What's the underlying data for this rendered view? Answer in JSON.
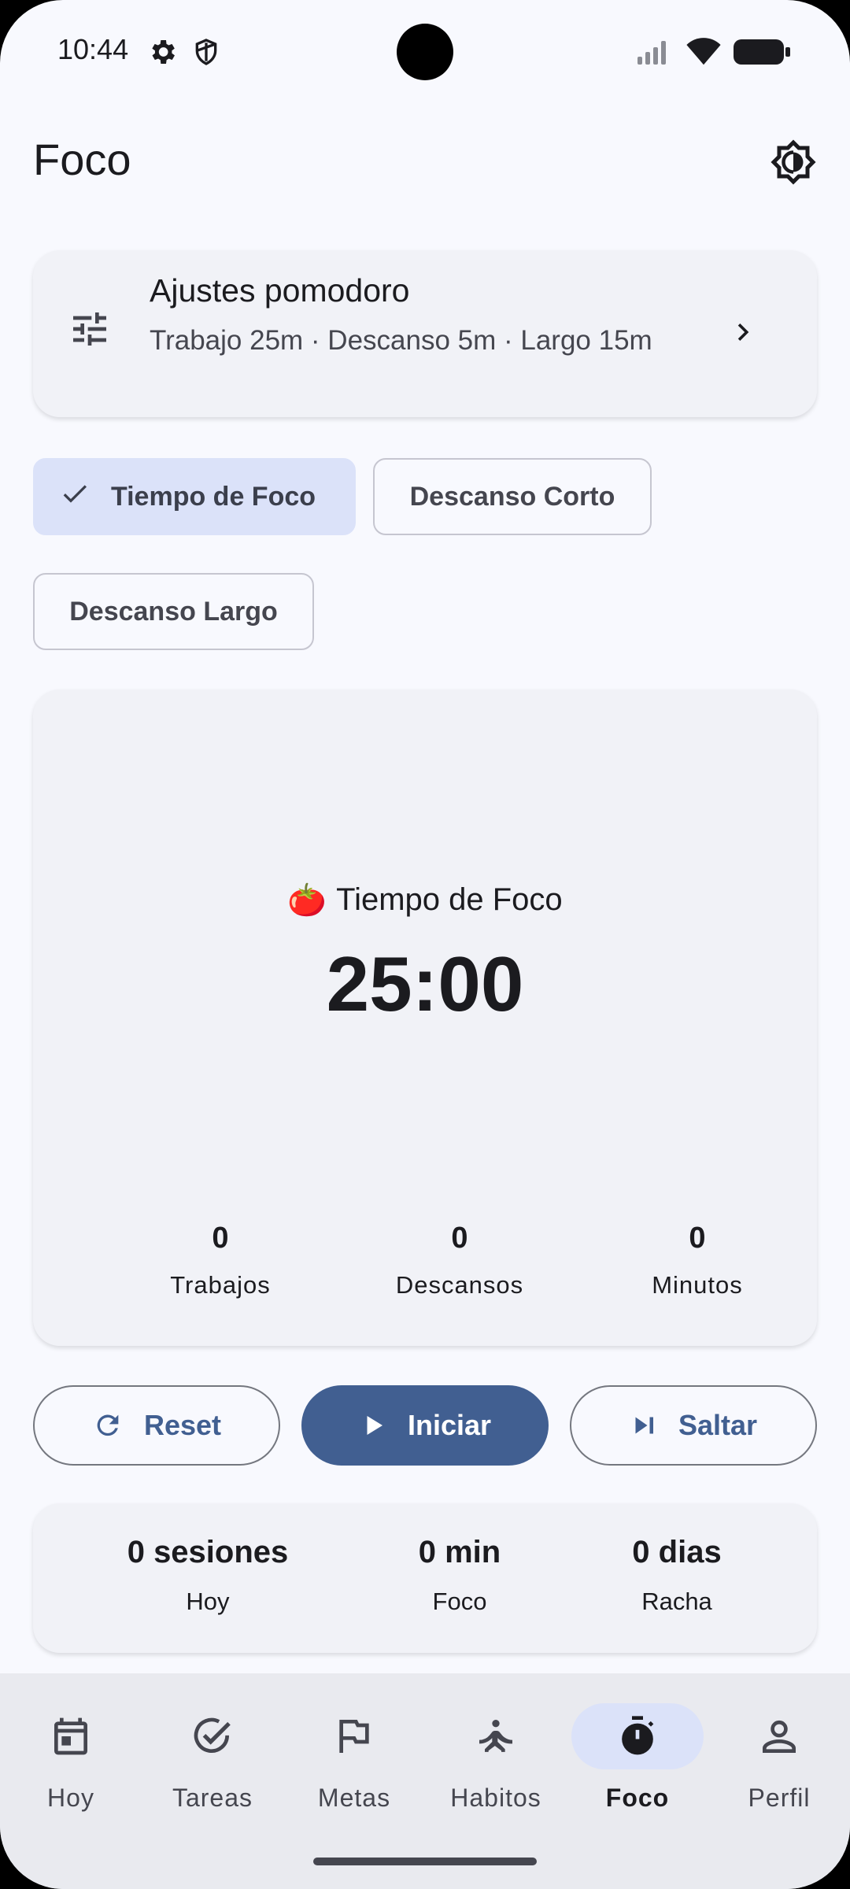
{
  "status_bar": {
    "time": "10:44",
    "left_icons": [
      "gear-icon",
      "shield-icon"
    ],
    "right_icons": [
      "signal-icon",
      "wifi-icon",
      "battery-icon"
    ]
  },
  "header": {
    "title": "Foco",
    "theme_icon": "brightness-icon"
  },
  "settings_card": {
    "title": "Ajustes pomodoro",
    "subtitle": "Trabajo 25m · Descanso 5m · Largo 15m"
  },
  "mode_chips": [
    {
      "label": "Tiempo de Foco",
      "selected": true
    },
    {
      "label": "Descanso Corto",
      "selected": false
    },
    {
      "label": "Descanso Largo",
      "selected": false
    }
  ],
  "timer": {
    "emoji": "🍅",
    "mode_label": "Tiempo de Foco",
    "display": "25:00",
    "counters": [
      {
        "value": "0",
        "label": "Trabajos"
      },
      {
        "value": "0",
        "label": "Descansos"
      },
      {
        "value": "0",
        "label": "Minutos"
      }
    ]
  },
  "controls": {
    "reset": "Reset",
    "start": "Iniciar",
    "skip": "Saltar"
  },
  "stats": [
    {
      "value": "0 sesiones",
      "label": "Hoy"
    },
    {
      "value": "0 min",
      "label": "Foco"
    },
    {
      "value": "0 dias",
      "label": "Racha"
    }
  ],
  "nav": [
    {
      "label": "Hoy",
      "icon": "calendar-icon",
      "active": false
    },
    {
      "label": "Tareas",
      "icon": "check-circle-icon",
      "active": false
    },
    {
      "label": "Metas",
      "icon": "flag-icon",
      "active": false
    },
    {
      "label": "Habitos",
      "icon": "meditation-icon",
      "active": false
    },
    {
      "label": "Foco",
      "icon": "timer-icon",
      "active": true
    },
    {
      "label": "Perfil",
      "icon": "person-icon",
      "active": false
    }
  ],
  "colors": {
    "background": "#f8f9fe",
    "surface": "#f1f2f7",
    "primary": "#415f91",
    "secondary_container": "#dbe2f9",
    "nav_background": "#e9eaef"
  }
}
